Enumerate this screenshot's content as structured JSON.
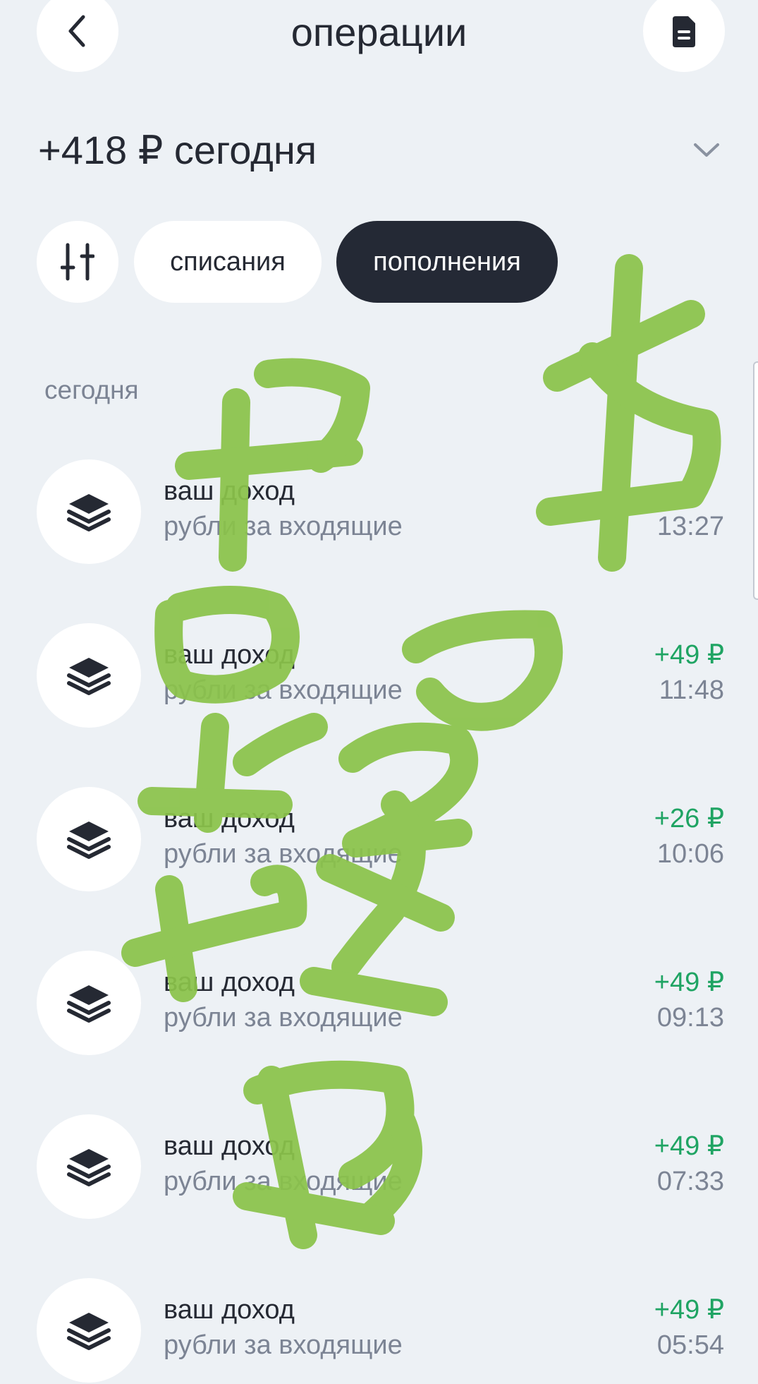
{
  "header": {
    "title": "операции",
    "back_icon": "chevron-left-icon",
    "document_icon": "document-icon"
  },
  "summary": {
    "text": "+418 ₽ сегодня",
    "chevron_icon": "chevron-down-icon"
  },
  "filters": {
    "settings_icon": "sliders-icon",
    "chips": [
      {
        "label": "списания",
        "selected": false
      },
      {
        "label": "пополнения",
        "selected": true
      }
    ]
  },
  "section": {
    "label": "сегодня"
  },
  "transactions": [
    {
      "title": "ваш доход",
      "subtitle": "рубли за входящие",
      "amount": "",
      "time": "13:27",
      "icon": "stack-layers-icon"
    },
    {
      "title": "ваш доход",
      "subtitle": "рубли за входящие",
      "amount": "+49 ₽",
      "time": "11:48",
      "icon": "stack-layers-icon"
    },
    {
      "title": "ваш доход",
      "subtitle": "рубли за входящие",
      "amount": "+26 ₽",
      "time": "10:06",
      "icon": "stack-layers-icon"
    },
    {
      "title": "ваш доход",
      "subtitle": "рубли за входящие",
      "amount": "+49 ₽",
      "time": "09:13",
      "icon": "stack-layers-icon"
    },
    {
      "title": "ваш доход",
      "subtitle": "рубли за входящие",
      "amount": "+49 ₽",
      "time": "07:33",
      "icon": "stack-layers-icon"
    },
    {
      "title": "ваш доход",
      "subtitle": "рубли за входящие",
      "amount": "+49 ₽",
      "time": "05:54",
      "icon": "stack-layers-icon"
    }
  ],
  "colors": {
    "background": "#edf1f5",
    "primary_text": "#252933",
    "secondary_text": "#7c8494",
    "income_green": "#1fa463",
    "selected_chip": "#242935",
    "scribble_green": "#8bc34a"
  }
}
